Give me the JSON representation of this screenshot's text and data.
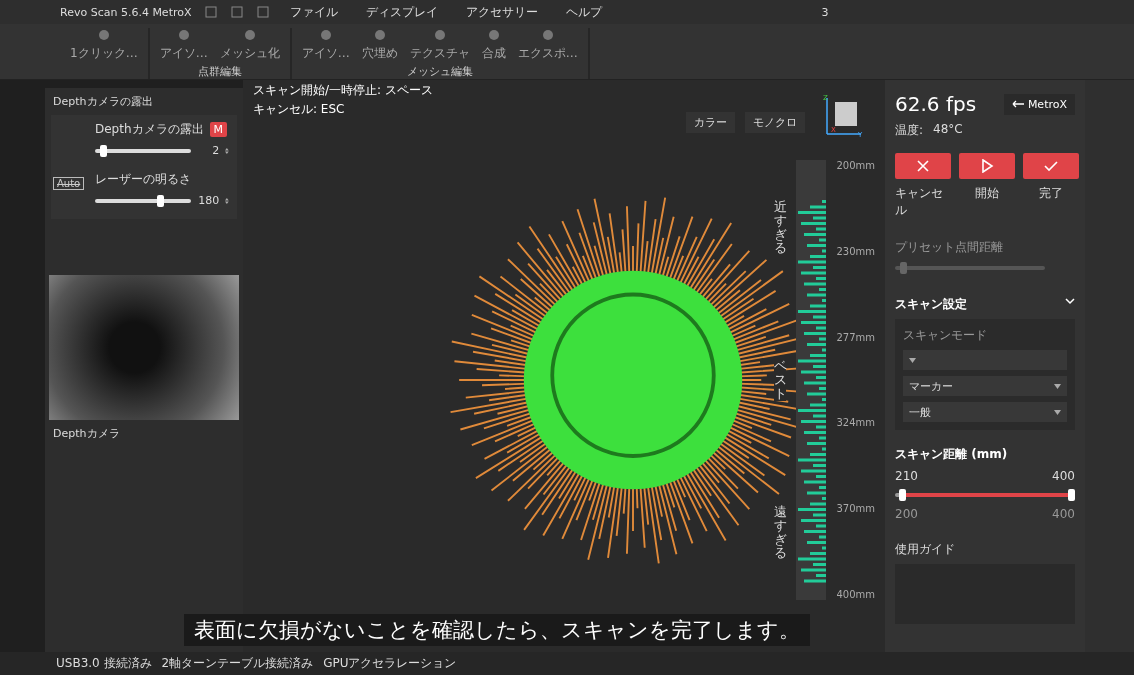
{
  "window": {
    "title": "Revo Scan 5.6.4 MetroX",
    "page": "3"
  },
  "menu": [
    "ファイル",
    "ディスプレイ",
    "アクセサリー",
    "ヘルプ"
  ],
  "toolbar": {
    "groups": [
      {
        "tools": [
          "1クリック…"
        ]
      },
      {
        "label": "点群編集",
        "tools": [
          "アイソ…",
          "メッシュ化"
        ]
      },
      {
        "label": "メッシュ編集",
        "tools": [
          "アイソ…",
          "穴埋め",
          "テクスチャ",
          "合成",
          "エクスポ…"
        ]
      }
    ]
  },
  "left_panel": {
    "title": "Depthカメラの露出",
    "exposure": {
      "label": "Depthカメラの露出",
      "badge": "M",
      "value": "2",
      "level": 0.08
    },
    "laser": {
      "label": "レーザーの明るさ",
      "value": "180",
      "level": 0.68
    },
    "auto": {
      "label": "Auto",
      "on": false
    },
    "camera_caption": "Depthカメラ"
  },
  "viewport": {
    "hints": [
      "スキャン開始/一時停止: スペース",
      "キャンセル: ESC"
    ],
    "view_modes": [
      {
        "label": "カラー",
        "selected": false
      },
      {
        "label": "モノクロ",
        "selected": false
      }
    ],
    "axes": [
      "Z",
      "X",
      "Y"
    ],
    "gauge": {
      "ticks": [
        "200mm",
        "230mm",
        "277mm",
        "324mm",
        "370mm",
        "400mm"
      ],
      "zones": [
        "近すぎる",
        "ベスト",
        "遠すぎる"
      ]
    }
  },
  "right_panel": {
    "fps": "62.6 fps",
    "temperature_label": "温度:",
    "temperature": "48°C",
    "device": "MetroX",
    "actions": [
      {
        "kind": "cancel",
        "label": "キャンセル"
      },
      {
        "kind": "start",
        "label": "開始"
      },
      {
        "kind": "finish",
        "label": "完了"
      }
    ],
    "preset": {
      "label": "プリセット点間距離",
      "disabled": true,
      "level": 0.05
    },
    "scan_settings": {
      "title": "スキャン設定",
      "expanded": true,
      "fields": [
        {
          "label": "スキャンモード"
        },
        {
          "value": "マーカー"
        },
        {
          "value": "一般"
        }
      ]
    },
    "distance": {
      "title": "スキャン距離 (mm)",
      "low": "210",
      "high": "400",
      "min": "200",
      "max": "400",
      "low_handle": {
        "level": 0.04
      },
      "high_handle": {
        "level": 1
      }
    },
    "guide_title": "使用ガイド"
  },
  "subtitle": "表面に欠損がないことを確認したら、スキャンを完了します。",
  "status_bar": [
    "USB3.0 接続済み",
    "2軸ターンテーブル接続済み",
    "GPUアクセラレーション"
  ]
}
